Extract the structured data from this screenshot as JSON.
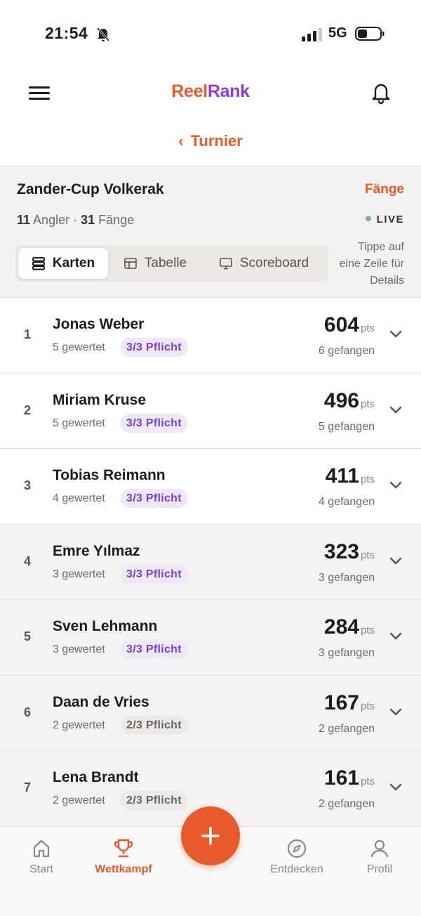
{
  "status": {
    "time": "21:54",
    "network": "5G"
  },
  "header": {
    "logo_part1": "Reel",
    "logo_part2": "Rank",
    "back_label": "Turnier"
  },
  "tournament": {
    "title": "Zander-Cup Volkerak",
    "faenge_link": "Fänge",
    "anglers_count": "11",
    "anglers_label": "Angler",
    "separator": "·",
    "catches_count": "31",
    "catches_label": "Fänge",
    "live_label": "LIVE"
  },
  "view_tabs": [
    {
      "label": "Karten",
      "icon": "cards-icon",
      "active": true
    },
    {
      "label": "Tabelle",
      "icon": "table-icon",
      "active": false
    },
    {
      "label": "Scoreboard",
      "icon": "monitor-icon",
      "active": false
    }
  ],
  "hint": "Tippe auf eine Zeile für Details",
  "leaderboard": [
    {
      "rank": "1",
      "name": "Jonas Weber",
      "scored": "5 gewertet",
      "badge": "3/3 Pflicht",
      "points": "604",
      "unit": "pts",
      "caught": "6 gefangen"
    },
    {
      "rank": "2",
      "name": "Miriam Kruse",
      "scored": "5 gewertet",
      "badge": "3/3 Pflicht",
      "points": "496",
      "unit": "pts",
      "caught": "5 gefangen"
    },
    {
      "rank": "3",
      "name": "Tobias Reimann",
      "scored": "4 gewertet",
      "badge": "3/3 Pflicht",
      "points": "411",
      "unit": "pts",
      "caught": "4 gefangen"
    },
    {
      "rank": "4",
      "name": "Emre Yılmaz",
      "scored": "3 gewertet",
      "badge": "3/3 Pflicht",
      "points": "323",
      "unit": "pts",
      "caught": "3 gefangen"
    },
    {
      "rank": "5",
      "name": "Sven Lehmann",
      "scored": "3 gewertet",
      "badge": "3/3 Pflicht",
      "points": "284",
      "unit": "pts",
      "caught": "3 gefangen"
    },
    {
      "rank": "6",
      "name": "Daan de Vries",
      "scored": "2 gewertet",
      "badge": "2/3 Pflicht",
      "points": "167",
      "unit": "pts",
      "caught": "2 gefangen"
    },
    {
      "rank": "7",
      "name": "Lena Brandt",
      "scored": "2 gewertet",
      "badge": "2/3 Pflicht",
      "points": "161",
      "unit": "pts",
      "caught": "2 gefangen"
    }
  ],
  "tabbar": {
    "start": "Start",
    "wettkampf": "Wettkampf",
    "entdecken": "Entdecken",
    "profil": "Profil"
  },
  "colors": {
    "accent": "#e65a2b",
    "purple": "#8c3fd8",
    "badge_purple_text": "#7b3fd1",
    "live_dot": "#6fbf8f"
  }
}
